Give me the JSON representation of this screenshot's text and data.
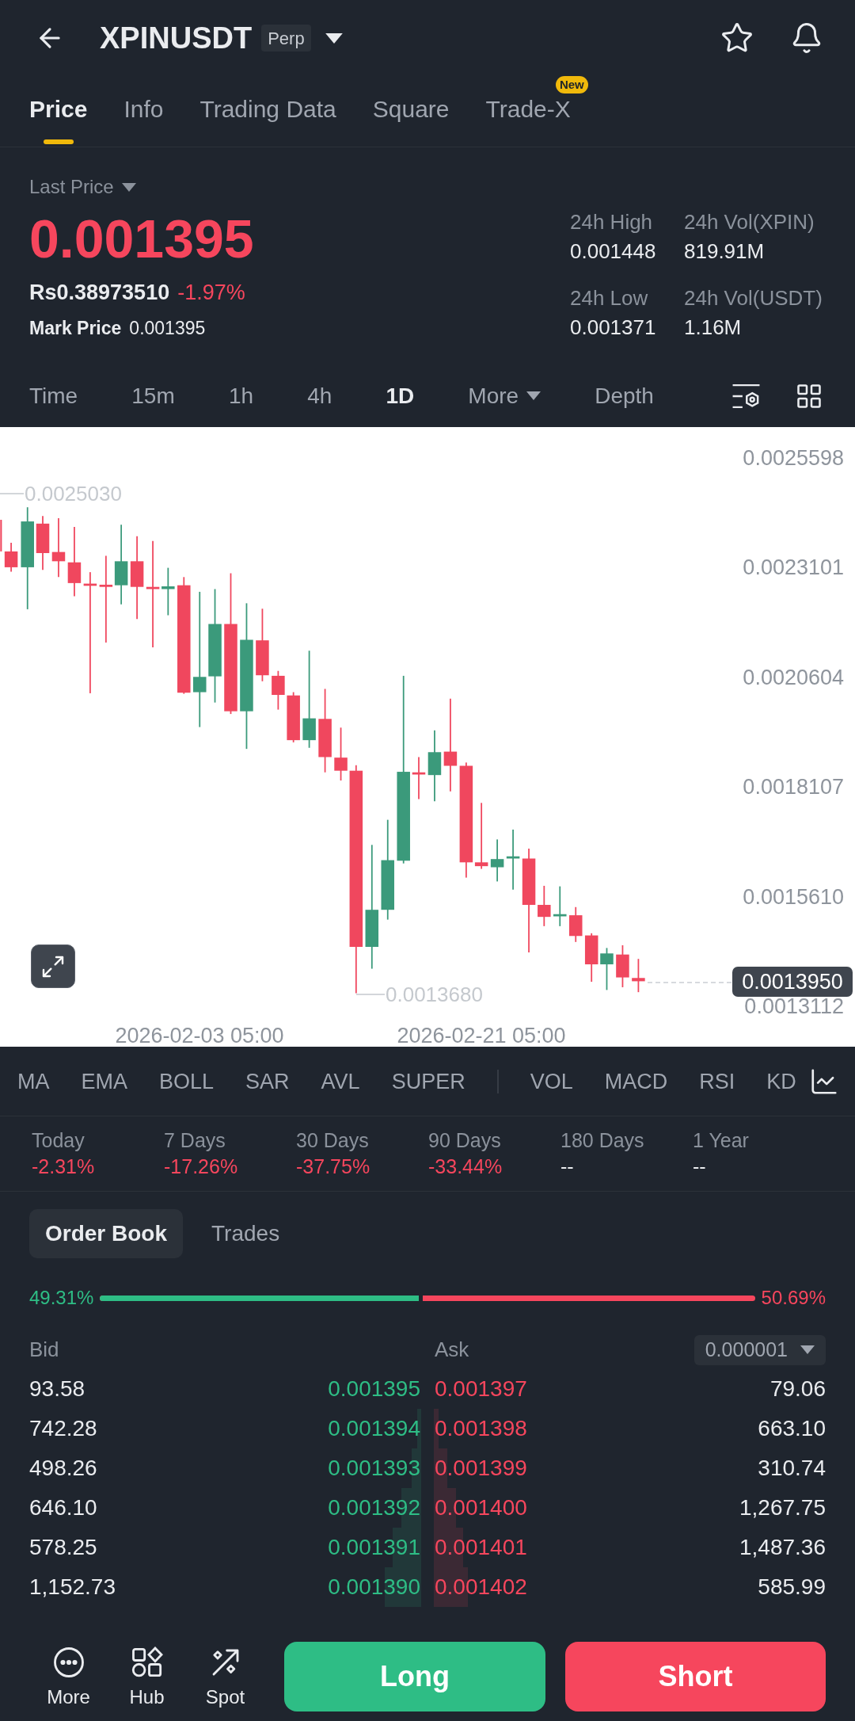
{
  "header": {
    "title": "XPINUSDT",
    "badge": "Perp"
  },
  "tabs": [
    {
      "label": "Price",
      "selected": true
    },
    {
      "label": "Info",
      "selected": false
    },
    {
      "label": "Trading Data",
      "selected": false
    },
    {
      "label": "Square",
      "selected": false
    },
    {
      "label": "Trade-X",
      "selected": false,
      "badge": "New"
    }
  ],
  "price_panel": {
    "label": "Last Price",
    "last_price": "0.001395",
    "negative": true,
    "fiat_price": "Rs0.38973510",
    "change": "-1.97%",
    "mark_price_label": "Mark Price",
    "mark_price": "0.001395",
    "stats": [
      {
        "label": "24h High",
        "value": "0.001448"
      },
      {
        "label": "24h Vol(XPIN)",
        "value": "819.91M"
      },
      {
        "label": "24h Low",
        "value": "0.001371"
      },
      {
        "label": "24h Vol(USDT)",
        "value": "1.16M"
      }
    ]
  },
  "intervals": [
    {
      "label": "Time",
      "kind": "option",
      "selected": false
    },
    {
      "label": "15m",
      "kind": "option",
      "selected": false
    },
    {
      "label": "1h",
      "kind": "option",
      "selected": false
    },
    {
      "label": "4h",
      "kind": "option",
      "selected": false
    },
    {
      "label": "1D",
      "kind": "option",
      "selected": true
    },
    {
      "label": "More",
      "kind": "menu",
      "selected": false
    },
    {
      "label": "Depth",
      "kind": "option",
      "selected": false
    }
  ],
  "chart": {
    "y_axis_labels": [
      "0.0025598",
      "0.0023101",
      "0.0020604",
      "0.0018107",
      "0.0015610",
      "0.0013112"
    ],
    "x_axis_labels": [
      "2026-02-03 05:00",
      "2026-02-21 05:00"
    ],
    "high_marker": "0.0025030",
    "low_marker": "0.0013680",
    "current_price": "0.0013950"
  },
  "indicators": {
    "main": [
      "MA",
      "EMA",
      "BOLL",
      "SAR",
      "AVL",
      "SUPER"
    ],
    "sub": [
      "VOL",
      "MACD",
      "RSI",
      "KD"
    ]
  },
  "performance": [
    {
      "label": "Today",
      "value": "-2.31%",
      "negative": true
    },
    {
      "label": "7 Days",
      "value": "-17.26%",
      "negative": true
    },
    {
      "label": "30 Days",
      "value": "-37.75%",
      "negative": true
    },
    {
      "label": "90 Days",
      "value": "-33.44%",
      "negative": true
    },
    {
      "label": "180 Days",
      "value": "--",
      "negative": false
    },
    {
      "label": "1 Year",
      "value": "--",
      "negative": false
    }
  ],
  "order_book": {
    "tabs": [
      {
        "label": "Order Book",
        "selected": true
      },
      {
        "label": "Trades",
        "selected": false
      }
    ],
    "bid_share": "49.31%",
    "ask_share": "50.69%",
    "ratio_bar": {
      "level": 0.4931
    },
    "bid_label": "Bid",
    "ask_label": "Ask",
    "precision": "0.000001",
    "rows": [
      {
        "bid_amount": "93.58",
        "bid_price": "0.001395",
        "ask_price": "0.001397",
        "ask_amount": "79.06"
      },
      {
        "bid_amount": "742.28",
        "bid_price": "0.001394",
        "ask_price": "0.001398",
        "ask_amount": "663.10"
      },
      {
        "bid_amount": "498.26",
        "bid_price": "0.001393",
        "ask_price": "0.001399",
        "ask_amount": "310.74"
      },
      {
        "bid_amount": "646.10",
        "bid_price": "0.001392",
        "ask_price": "0.001400",
        "ask_amount": "1,267.75"
      },
      {
        "bid_amount": "578.25",
        "bid_price": "0.001391",
        "ask_price": "0.001401",
        "ask_amount": "1,487.36"
      },
      {
        "bid_amount": "1,152.73",
        "bid_price": "0.001390",
        "ask_price": "0.001402",
        "ask_amount": "585.99"
      }
    ]
  },
  "bottom_bar": {
    "shortcuts": [
      {
        "label": "More",
        "kind": "more"
      },
      {
        "label": "Hub",
        "kind": "hub"
      },
      {
        "label": "Spot",
        "kind": "spot"
      }
    ],
    "long_button": "Long",
    "short_button": "Short"
  }
}
